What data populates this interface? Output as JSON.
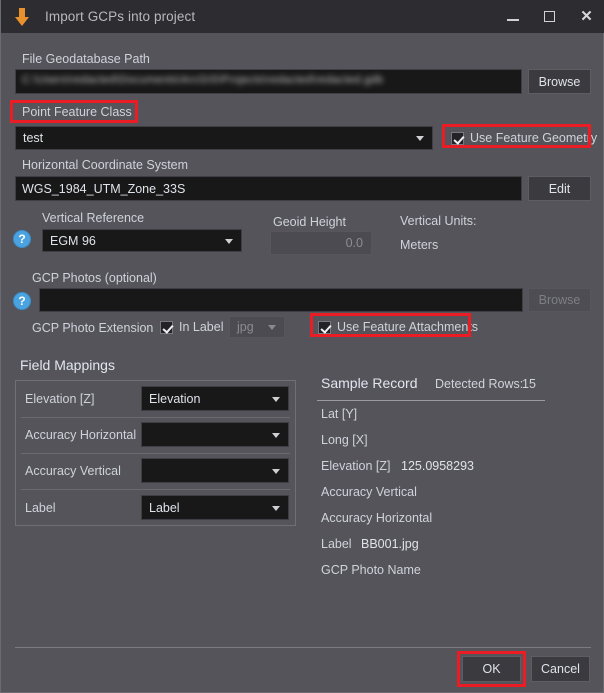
{
  "window": {
    "title": "Import GCPs into project",
    "icon": "down-arrow-icon",
    "minimize": "_",
    "maximize": "□",
    "close": "✕"
  },
  "form": {
    "gdb_path_label": "File Geodatabase Path",
    "gdb_path_value": "C:\\Users\\redacted\\Documents\\ArcGIS\\Projects\\redacted\\redacted.gdb",
    "gdb_path_redacted": true,
    "browse_label": "Browse",
    "point_feature_class_label": "Point Feature Class",
    "point_feature_class_value": "test",
    "use_feature_geometry_label": "Use Feature Geometry",
    "use_feature_geometry_checked": true,
    "horizontal_cs_label": "Horizontal Coordinate System",
    "horizontal_cs_value": "WGS_1984_UTM_Zone_33S",
    "edit_label": "Edit",
    "vertical_reference_label": "Vertical Reference",
    "vertical_reference_value": "EGM 96",
    "geoid_height_label": "Geoid Height",
    "geoid_height_value": "0.0",
    "vertical_units_label": "Vertical Units:",
    "vertical_units_value": "Meters",
    "gcp_photos_label": "GCP Photos (optional)",
    "gcp_photos_value": "",
    "gcp_photos_browse_label": "Browse",
    "gcp_photo_extension_label": "GCP Photo Extension",
    "in_label_label": "In Label",
    "in_label_checked": true,
    "extension_value": "jpg",
    "use_feature_attachments_label": "Use Feature Attachments",
    "use_feature_attachments_checked": true,
    "help_icon": "?"
  },
  "field_mappings": {
    "title": "Field Mappings",
    "rows": [
      {
        "label": "Elevation [Z]",
        "value": "Elevation"
      },
      {
        "label": "Accuracy Horizontal",
        "value": ""
      },
      {
        "label": "Accuracy Vertical",
        "value": ""
      },
      {
        "label": "Label",
        "value": "Label"
      }
    ]
  },
  "sample_record": {
    "title": "Sample Record",
    "detected_rows_label": "Detected Rows:",
    "detected_rows_value": "15",
    "rows": [
      {
        "label": "Lat [Y]",
        "value": ""
      },
      {
        "label": "Long [X]",
        "value": ""
      },
      {
        "label": "Elevation [Z]",
        "value": "125.0958293"
      },
      {
        "label": "Accuracy Vertical",
        "value": ""
      },
      {
        "label": "Accuracy Horizontal",
        "value": ""
      },
      {
        "label": "Label",
        "value": "BB001.jpg"
      },
      {
        "label": "GCP Photo Name",
        "value": ""
      }
    ]
  },
  "footer": {
    "ok_label": "OK",
    "cancel_label": "Cancel"
  },
  "annotations": {
    "color": "#ec1c24",
    "targets": [
      "point-feature-class-label",
      "use-feature-geometry-checkbox",
      "use-feature-attachments-checkbox",
      "ok-button"
    ]
  }
}
